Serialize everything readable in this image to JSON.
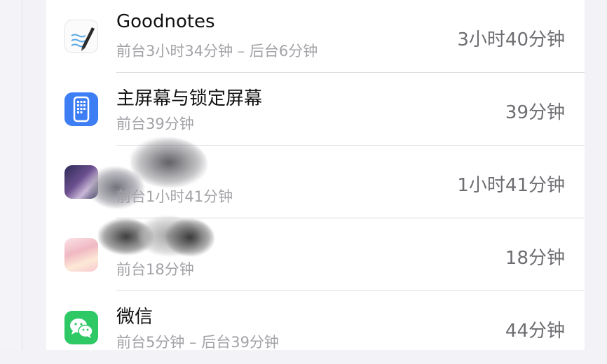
{
  "apps": [
    {
      "name": "Goodnotes",
      "subtitle": "前台3小时34分钟 – 后台6分钟",
      "time": "3小时40分钟",
      "icon": "goodnotes-icon",
      "icon_color": "#ffffff"
    },
    {
      "name": "主屏幕与锁定屏幕",
      "subtitle": "前台39分钟",
      "time": "39分钟",
      "icon": "home-screen-icon",
      "icon_color": "#3d7ef5"
    },
    {
      "name": "",
      "subtitle": "前台1小时41分钟",
      "time": "1小时41分钟",
      "icon": "app-icon",
      "icon_color": "#3a3560",
      "redacted": true
    },
    {
      "name": "",
      "subtitle": "前台18分钟",
      "time": "18分钟",
      "icon": "app-icon",
      "icon_color": "#f3c9cf",
      "redacted": true
    },
    {
      "name": "微信",
      "subtitle": "前台5分钟 – 后台39分钟",
      "time": "44分钟",
      "icon": "wechat-icon",
      "icon_color": "#2ec865"
    }
  ]
}
